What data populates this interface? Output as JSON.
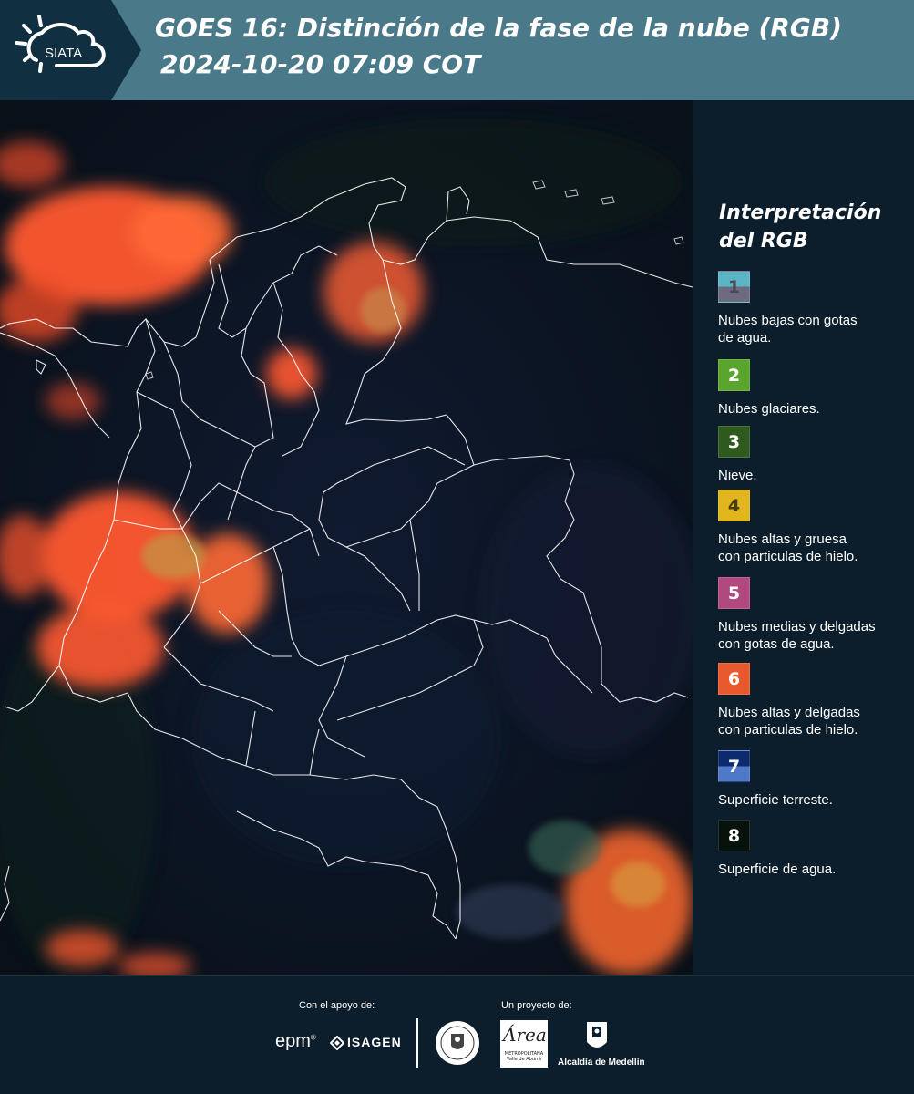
{
  "header": {
    "logo_text": "SIATA",
    "title_line1": "GOES 16: Distinción de la fase de la nube (RGB)",
    "title_line2": "2024-10-20 07:09 COT"
  },
  "legend": {
    "title_line1": "Interpretación",
    "title_line2": "del RGB",
    "items": [
      {
        "number": "1",
        "label_lines": [
          "Nubes bajas con gotas",
          "de agua."
        ],
        "colors": [
          "#5bb6c4",
          "#6e6a80"
        ],
        "num_color": "#4a4a5a"
      },
      {
        "number": "2",
        "label_lines": [
          "Nubes glaciares."
        ],
        "colors": [
          "#5aa62d"
        ],
        "num_color": "#ffffff"
      },
      {
        "number": "3",
        "label_lines": [
          "Nieve."
        ],
        "colors": [
          "#2f5a1e"
        ],
        "num_color": "#ffffff"
      },
      {
        "number": "4",
        "label_lines": [
          "Nubes altas y gruesa",
          "con particulas de hielo."
        ],
        "colors": [
          "#e0b51e"
        ],
        "num_color": "#4a3d10"
      },
      {
        "number": "5",
        "label_lines": [
          "Nubes medias y delgadas",
          "con gotas de agua."
        ],
        "colors": [
          "#b04a7e"
        ],
        "num_color": "#ffffff"
      },
      {
        "number": "6",
        "label_lines": [
          "Nubes altas y delgadas",
          "con particulas de hielo."
        ],
        "colors": [
          "#e85a2e"
        ],
        "num_color": "#ffffff"
      },
      {
        "number": "7",
        "label_lines": [
          "Superficie terreste."
        ],
        "colors": [
          "#0e2a6e",
          "#4e78c8"
        ],
        "num_color": "#ffffff"
      },
      {
        "number": "8",
        "label_lines": [
          "Superficie de agua."
        ],
        "colors": [
          "#07120c"
        ],
        "num_color": "#ffffff"
      }
    ]
  },
  "footer": {
    "support_label": "Con el apoyo de:",
    "project_label": "Un proyecto de:",
    "sponsor1": "epm",
    "sponsor2": "ISAGEN",
    "area_logo_text": "Área",
    "area_logo_sub": "METROPOLITANA Valle de Aburrá",
    "alcaldia": "Alcaldía de Medellín"
  },
  "colors": {
    "header_bg": "#4a7a8a",
    "panel_bg": "#0c1d2b",
    "cloud_ice": "#ff5a2e",
    "map_dark": "#0a1420"
  }
}
